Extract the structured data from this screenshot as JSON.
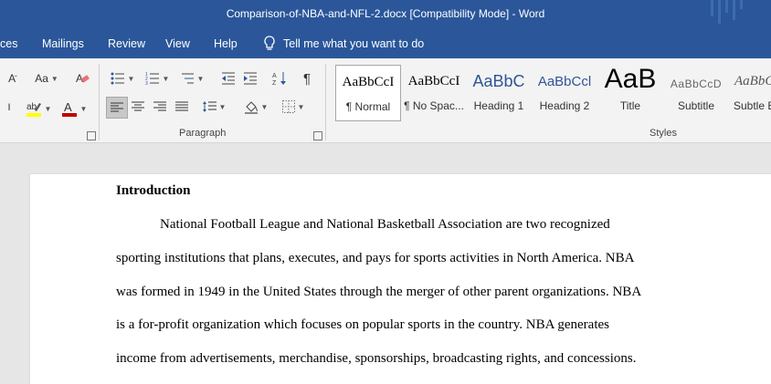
{
  "window": {
    "title": "Comparison-of-NBA-and-NFL-2.docx [Compatibility Mode]  -  Word"
  },
  "menu": {
    "items": [
      "ces",
      "Mailings",
      "Review",
      "View",
      "Help"
    ],
    "tell_me": "Tell me what you want to do",
    "tell_me_icon": "lightbulb-icon"
  },
  "ribbon": {
    "font_group": {
      "font_size_label": "Aa",
      "clear_label": "A"
    },
    "paragraph": {
      "label": "Paragraph",
      "pilcrow": "¶"
    },
    "styles": {
      "label": "Styles",
      "items": [
        {
          "sample": "AaBbCcI",
          "name": "¶ Normal"
        },
        {
          "sample": "AaBbCcI",
          "name": "¶ No Spac..."
        },
        {
          "sample": "AaBbC",
          "name": "Heading 1"
        },
        {
          "sample": "AaBbCcl",
          "name": "Heading 2"
        },
        {
          "sample": "AaB",
          "name": "Title"
        },
        {
          "sample": "AaBbCcD",
          "name": "Subtitle"
        },
        {
          "sample": "AaBbC",
          "name": "Subtle E"
        }
      ]
    },
    "colors": {
      "accent": "#2b579a",
      "highlight": "#ffff00",
      "font_color": "#c00000"
    }
  },
  "document": {
    "heading": "Introduction",
    "lines": [
      "National Football League and National Basketball Association are two recognized",
      "sporting institutions that plans, executes, and pays for sports activities in North America. NBA",
      "was formed in 1949 in the United States through the merger of other parent organizations. NBA",
      "is a for-profit organization which focuses on popular sports in the country. NBA generates",
      "income from advertisements, merchandise, sponsorships, broadcasting rights, and concessions."
    ]
  }
}
